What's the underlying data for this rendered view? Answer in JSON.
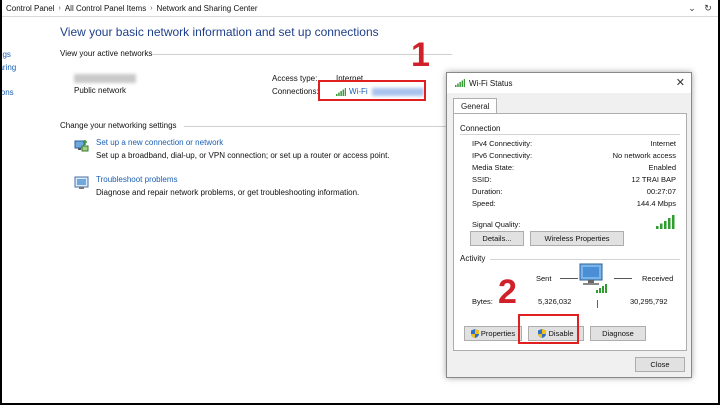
{
  "breadcrumb": [
    "Control Panel",
    "All Control Panel Items",
    "Network and Sharing Center"
  ],
  "sidebar_fragments": [
    "ngs",
    "haring",
    "ions"
  ],
  "main": {
    "title": "View your basic network information and set up connections",
    "active_networks_label": "View your active networks",
    "network_type": "Public network",
    "access_type_label": "Access type:",
    "access_type_value": "Internet",
    "connections_label": "Connections:",
    "connection_name": "Wi-Fi",
    "change_settings_label": "Change your networking settings",
    "settings": [
      {
        "title": "Set up a new connection or network",
        "desc": "Set up a broadband, dial-up, or VPN connection; or set up a router or access point."
      },
      {
        "title": "Troubleshoot problems",
        "desc": "Diagnose and repair network problems, or get troubleshooting information."
      }
    ]
  },
  "annotations": {
    "step1": "1",
    "step2": "2"
  },
  "dialog": {
    "title": "Wi-Fi Status",
    "tab": "General",
    "connection_group": "Connection",
    "rows": [
      {
        "label": "IPv4 Connectivity:",
        "value": "Internet"
      },
      {
        "label": "IPv6 Connectivity:",
        "value": "No network access"
      },
      {
        "label": "Media State:",
        "value": "Enabled"
      },
      {
        "label": "SSID:",
        "value": "12 TRAI BAP"
      },
      {
        "label": "Duration:",
        "value": "00:27:07"
      },
      {
        "label": "Speed:",
        "value": "144.4 Mbps"
      }
    ],
    "signal_quality_label": "Signal Quality:",
    "details_button": "Details...",
    "wireless_properties_button": "Wireless Properties",
    "activity_group": "Activity",
    "sent_label": "Sent",
    "received_label": "Received",
    "bytes_label": "Bytes:",
    "bytes_sent": "5,326,032",
    "bytes_received": "30,295,792",
    "properties_button": "Properties",
    "disable_button": "Disable",
    "diagnose_button": "Diagnose",
    "close_button": "Close"
  },
  "colors": {
    "link": "#1a5fb4",
    "title": "#1e3f8c",
    "highlight": "#e02020",
    "annotation": "#d0202a"
  }
}
